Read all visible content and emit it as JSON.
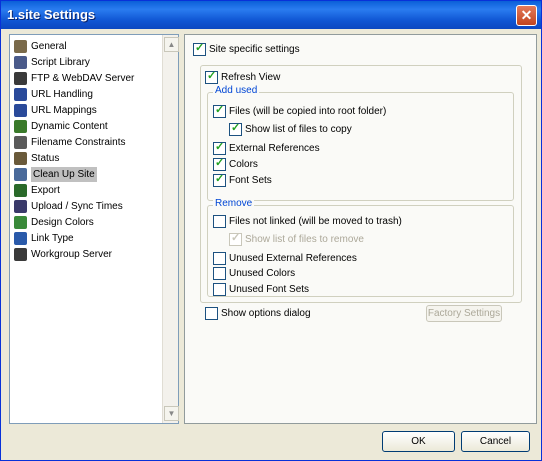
{
  "window": {
    "title": "1.site Settings",
    "close_glyph": "✕"
  },
  "tree": {
    "items": [
      {
        "label": "General",
        "icon": "general-icon",
        "color": "#7a6a4a"
      },
      {
        "label": "Script Library",
        "icon": "script-library-icon",
        "color": "#4a5a8a"
      },
      {
        "label": "FTP & WebDAV Server",
        "icon": "ftp-server-icon",
        "color": "#3a3a3a"
      },
      {
        "label": "URL Handling",
        "icon": "url-handling-icon",
        "color": "#2a4a9a"
      },
      {
        "label": "URL Mappings",
        "icon": "url-mappings-icon",
        "color": "#2a4a9a"
      },
      {
        "label": "Dynamic Content",
        "icon": "dynamic-content-icon",
        "color": "#3a7a2a"
      },
      {
        "label": "Filename Constraints",
        "icon": "filename-constraints-icon",
        "color": "#5a5a5a"
      },
      {
        "label": "Status",
        "icon": "status-icon",
        "color": "#6a5a3a"
      },
      {
        "label": "Clean Up Site",
        "icon": "clean-up-site-icon",
        "color": "#4a6a9a"
      },
      {
        "label": "Export",
        "icon": "export-icon",
        "color": "#2a6a2a"
      },
      {
        "label": "Upload / Sync Times",
        "icon": "upload-sync-icon",
        "color": "#3a3a6a"
      },
      {
        "label": "Design Colors",
        "icon": "design-colors-icon",
        "color": "#3a8a3a"
      },
      {
        "label": "Link Type",
        "icon": "link-type-icon",
        "color": "#2a5aaa"
      },
      {
        "label": "Workgroup Server",
        "icon": "workgroup-server-icon",
        "color": "#3a3a3a"
      }
    ],
    "selected_index": 8
  },
  "panel": {
    "site_specific_label": "Site specific settings",
    "refresh_view_label": "Refresh View",
    "add_used": {
      "title": "Add used",
      "files_label": "Files (will be copied into root folder)",
      "show_list_label": "Show list of files to copy",
      "external_refs_label": "External References",
      "colors_label": "Colors",
      "font_sets_label": "Font Sets"
    },
    "remove": {
      "title": "Remove",
      "files_not_linked_label": "Files not linked (will be moved to trash)",
      "show_list_remove_label": "Show list of files to remove",
      "unused_external_label": "Unused External References",
      "unused_colors_label": "Unused Colors",
      "unused_font_sets_label": "Unused Font Sets"
    },
    "show_options_label": "Show options dialog",
    "factory_settings_label": "Factory Settings"
  },
  "footer": {
    "ok_label": "OK",
    "cancel_label": "Cancel"
  }
}
